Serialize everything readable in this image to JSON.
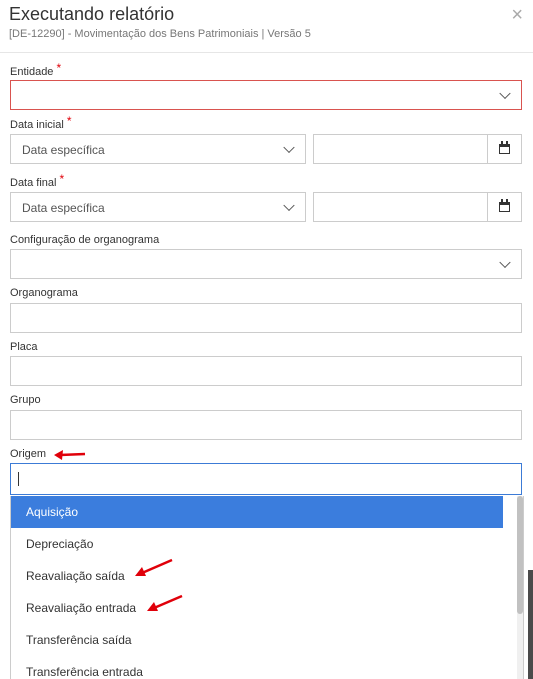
{
  "modal": {
    "title": "Executando relatório",
    "subtitle": "[DE-12290] - Movimentação dos Bens Patrimoniais | Versão 5",
    "close_icon": "×"
  },
  "fields": {
    "entidade": {
      "label": "Entidade",
      "required": "*"
    },
    "data_inicial": {
      "label": "Data inicial",
      "required": "*",
      "mode_value": "Data específica"
    },
    "data_final": {
      "label": "Data final",
      "required": "*",
      "mode_value": "Data específica"
    },
    "config_organograma": {
      "label": "Configuração de organograma"
    },
    "organograma": {
      "label": "Organograma"
    },
    "placa": {
      "label": "Placa"
    },
    "grupo": {
      "label": "Grupo"
    },
    "origem": {
      "label": "Origem"
    }
  },
  "origem_options": [
    "Aquisição",
    "Depreciação",
    "Reavaliação saída",
    "Reavaliação entrada",
    "Transferência saída",
    "Transferência entrada"
  ],
  "colors": {
    "accent": "#3b7ddd",
    "error_border": "#d9534f",
    "annotation_arrow": "#e0000a"
  }
}
